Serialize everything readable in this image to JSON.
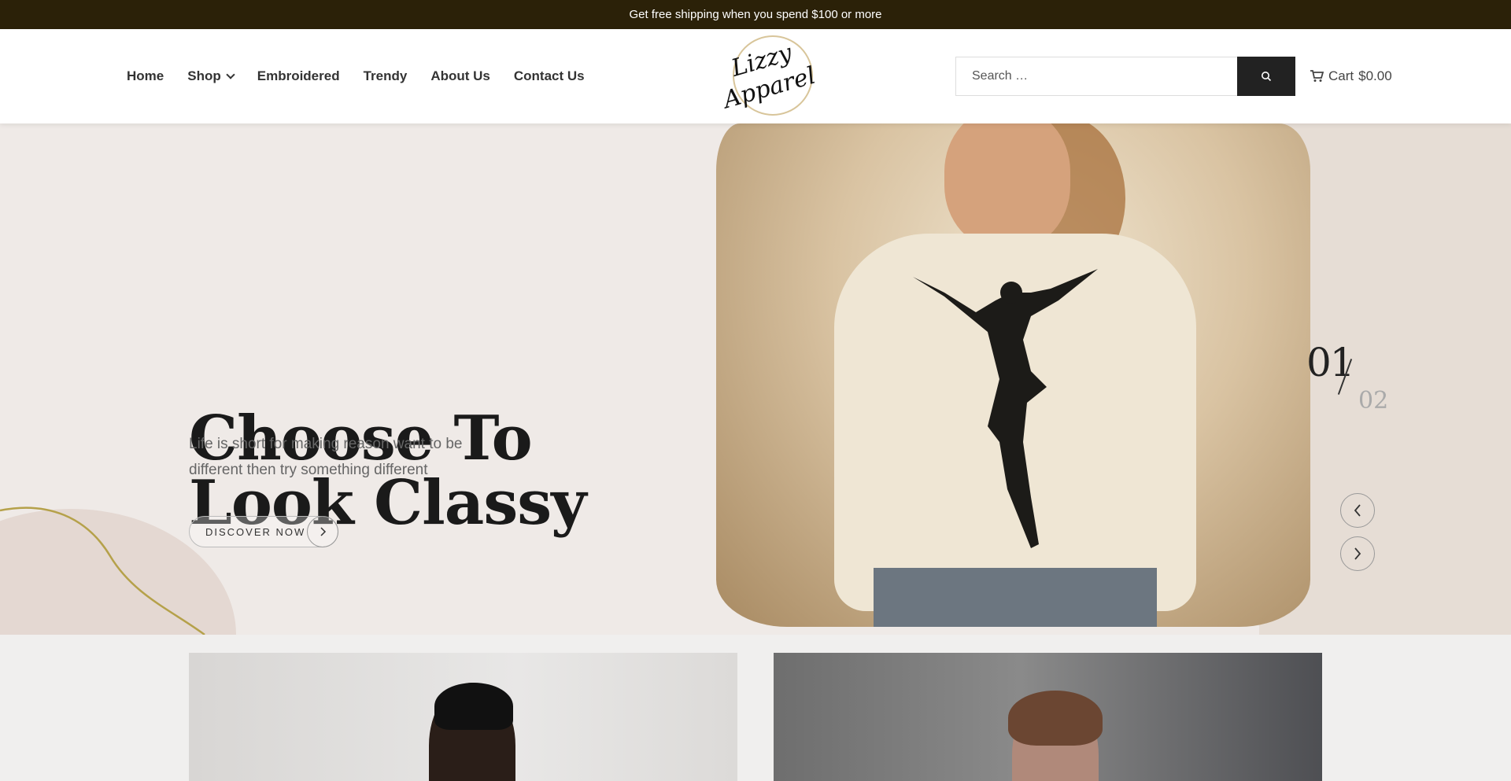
{
  "announcement": "Get free shipping when you spend $100 or more",
  "nav": {
    "items": [
      {
        "label": "Home",
        "has_dropdown": false
      },
      {
        "label": "Shop",
        "has_dropdown": true
      },
      {
        "label": "Embroidered",
        "has_dropdown": false
      },
      {
        "label": "Trendy",
        "has_dropdown": false
      },
      {
        "label": "About Us",
        "has_dropdown": false
      },
      {
        "label": "Contact Us",
        "has_dropdown": false
      }
    ]
  },
  "logo": {
    "line1": "Lizzy",
    "line2": "Apparel"
  },
  "search": {
    "placeholder": "Search …",
    "button_icon": "search-icon"
  },
  "cart": {
    "label": "Cart",
    "amount": "$0.00",
    "icon": "cart-icon"
  },
  "hero": {
    "title_line1": "Choose To",
    "title_line2": "Look Classy",
    "subtitle": "Life is short for making reason want to be different then try something different",
    "cta_label": "DISCOVER NOW",
    "slide_current": "01",
    "slide_total": "02",
    "prev_icon": "chevron-left-icon",
    "next_icon": "chevron-right-icon"
  },
  "colors": {
    "announcement_bg": "#2b2108",
    "button_dark": "#222222",
    "hero_bg": "#efeae7",
    "accent_gold": "#b5a14a"
  }
}
